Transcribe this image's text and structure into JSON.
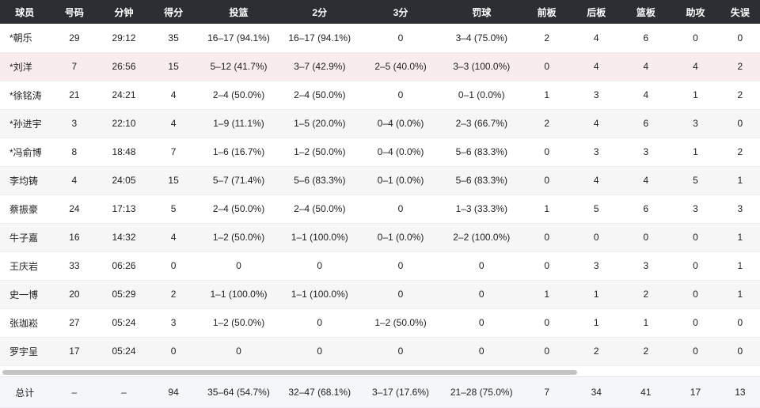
{
  "headers": [
    "球员",
    "号码",
    "分钟",
    "得分",
    "投篮",
    "2分",
    "3分",
    "罚球",
    "前板",
    "后板",
    "篮板",
    "助攻",
    "失误"
  ],
  "rows": [
    [
      "*朝乐",
      "29",
      "29:12",
      "35",
      "16–17 (94.1%)",
      "16–17 (94.1%)",
      "0",
      "3–4 (75.0%)",
      "2",
      "4",
      "6",
      "0",
      "0"
    ],
    [
      "*刘洋",
      "7",
      "26:56",
      "15",
      "5–12 (41.7%)",
      "3–7 (42.9%)",
      "2–5 (40.0%)",
      "3–3 (100.0%)",
      "0",
      "4",
      "4",
      "4",
      "2"
    ],
    [
      "*徐铭涛",
      "21",
      "24:21",
      "4",
      "2–4 (50.0%)",
      "2–4 (50.0%)",
      "0",
      "0–1 (0.0%)",
      "1",
      "3",
      "4",
      "1",
      "2"
    ],
    [
      "*孙进宇",
      "3",
      "22:10",
      "4",
      "1–9 (11.1%)",
      "1–5 (20.0%)",
      "0–4 (0.0%)",
      "2–3 (66.7%)",
      "2",
      "4",
      "6",
      "3",
      "0"
    ],
    [
      "*冯俞博",
      "8",
      "18:48",
      "7",
      "1–6 (16.7%)",
      "1–2 (50.0%)",
      "0–4 (0.0%)",
      "5–6 (83.3%)",
      "0",
      "3",
      "3",
      "1",
      "2"
    ],
    [
      "李均铸",
      "4",
      "24:05",
      "15",
      "5–7 (71.4%)",
      "5–6 (83.3%)",
      "0–1 (0.0%)",
      "5–6 (83.3%)",
      "0",
      "4",
      "4",
      "5",
      "1"
    ],
    [
      "蔡振豪",
      "24",
      "17:13",
      "5",
      "2–4 (50.0%)",
      "2–4 (50.0%)",
      "0",
      "1–3 (33.3%)",
      "1",
      "5",
      "6",
      "3",
      "3"
    ],
    [
      "牛子嘉",
      "16",
      "14:32",
      "4",
      "1–2 (50.0%)",
      "1–1 (100.0%)",
      "0–1 (0.0%)",
      "2–2 (100.0%)",
      "0",
      "0",
      "0",
      "0",
      "1"
    ],
    [
      "王庆岩",
      "33",
      "06:26",
      "0",
      "0",
      "0",
      "0",
      "0",
      "0",
      "3",
      "3",
      "0",
      "1"
    ],
    [
      "史一博",
      "20",
      "05:29",
      "2",
      "1–1 (100.0%)",
      "1–1 (100.0%)",
      "0",
      "0",
      "1",
      "1",
      "2",
      "0",
      "1"
    ],
    [
      "张珈崧",
      "27",
      "05:24",
      "3",
      "1–2 (50.0%)",
      "0",
      "1–2 (50.0%)",
      "0",
      "0",
      "1",
      "1",
      "0",
      "0"
    ],
    [
      "罗宇呈",
      "17",
      "05:24",
      "0",
      "0",
      "0",
      "0",
      "0",
      "0",
      "2",
      "2",
      "0",
      "0"
    ]
  ],
  "highlight_row": 1,
  "totals": [
    "总计",
    "–",
    "–",
    "94",
    "35–64 (54.7%)",
    "32–47 (68.1%)",
    "3–17 (17.6%)",
    "21–28 (75.0%)",
    "7",
    "34",
    "41",
    "17",
    "13"
  ]
}
